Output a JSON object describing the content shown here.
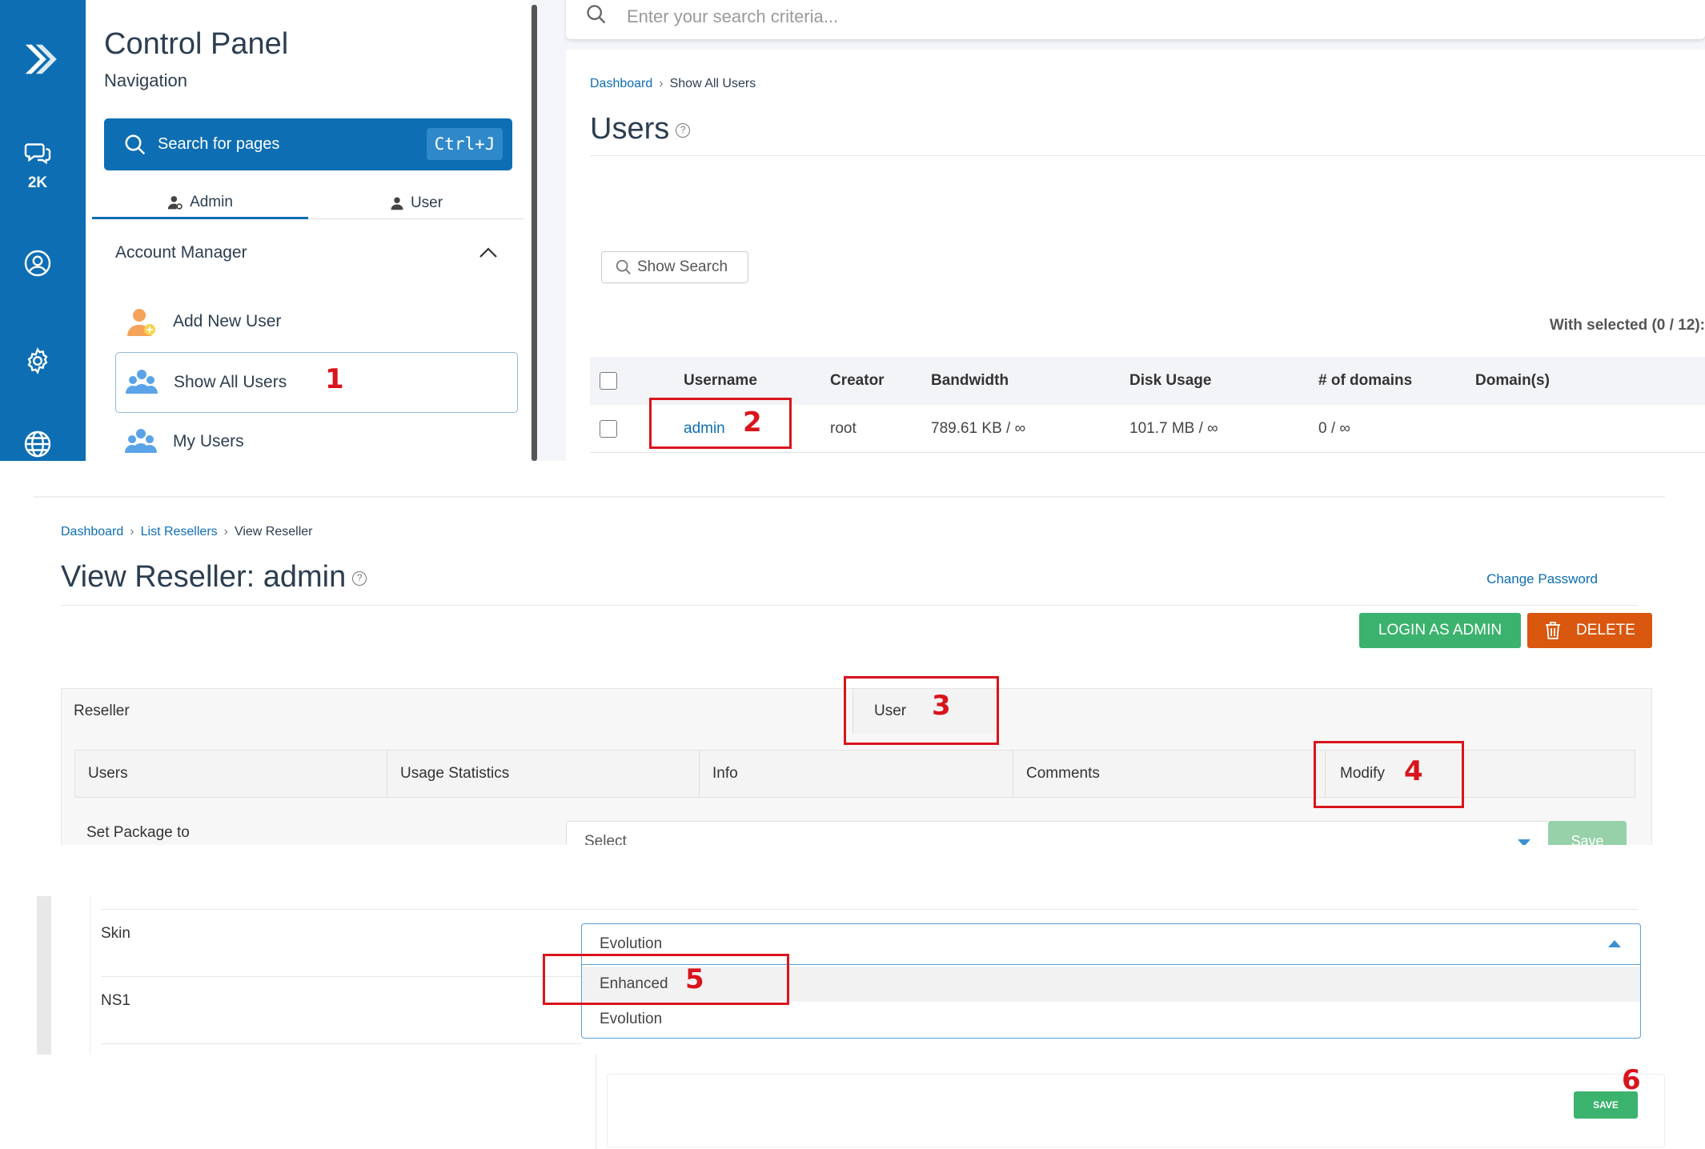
{
  "panel1": {
    "rail": {
      "chat_count": "2K"
    },
    "nav": {
      "title": "Control Panel",
      "subtitle": "Navigation",
      "search_label": "Search for pages",
      "search_shortcut": "Ctrl+J",
      "tabs": [
        {
          "label": "Admin"
        },
        {
          "label": "User"
        }
      ],
      "section": "Account Manager",
      "items": [
        {
          "label": "Add New User"
        },
        {
          "label": "Show All Users"
        },
        {
          "label": "My Users"
        }
      ]
    },
    "top_search_placeholder": "Enter your search criteria...",
    "breadcrumb": {
      "home": "Dashboard",
      "current": "Show All Users"
    },
    "page_title": "Users",
    "show_search": "Show Search",
    "with_selected": "With selected (0 / 12):",
    "table": {
      "columns": [
        "Username",
        "Creator",
        "Bandwidth",
        "Disk Usage",
        "# of domains",
        "Domain(s)"
      ],
      "rows": [
        {
          "username": "admin",
          "creator": "root",
          "bandwidth": "789.61 KB / ∞",
          "disk": "101.7 MB / ∞",
          "domains": "0 / ∞",
          "domain_list": ""
        }
      ]
    }
  },
  "panel2": {
    "breadcrumb": {
      "home": "Dashboard",
      "mid": "List Resellers",
      "current": "View Reseller"
    },
    "page_title": "View Reseller: admin",
    "change_password": "Change Password",
    "login_button": "LOGIN AS ADMIN",
    "delete_button": "DELETE",
    "outer_tabs": [
      "Reseller",
      "User"
    ],
    "inner_tabs": [
      "Users",
      "Usage Statistics",
      "Info",
      "Comments",
      "Modify"
    ],
    "package_label": "Set Package to",
    "package_value": "Select",
    "package_save": "Save"
  },
  "panel3": {
    "skin_label": "Skin",
    "skin_value": "Evolution",
    "skin_options": [
      "Enhanced",
      "Evolution"
    ],
    "ns1_label": "NS1"
  },
  "panel4": {
    "save_label": "SAVE"
  },
  "annotations": [
    "1",
    "2",
    "3",
    "4",
    "5",
    "6"
  ],
  "colors": {
    "primary": "#0d6eb3",
    "green": "#3bb26d",
    "orange": "#d9570f",
    "annotation": "#d9141c"
  }
}
